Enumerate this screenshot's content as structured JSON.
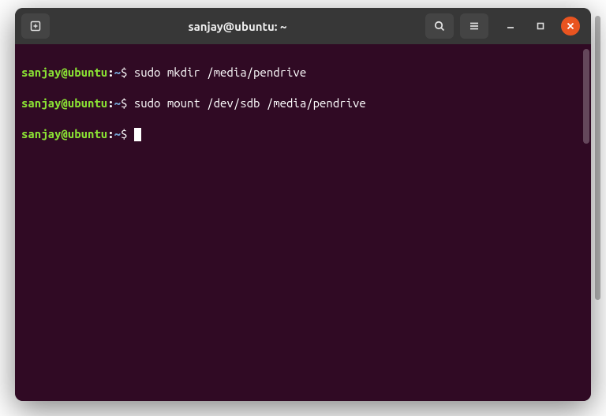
{
  "window": {
    "title": "sanjay@ubuntu: ~"
  },
  "terminal": {
    "lines": [
      {
        "user_host": "sanjay@ubuntu",
        "path": "~",
        "symbol": "$",
        "command": "sudo mkdir /media/pendrive"
      },
      {
        "user_host": "sanjay@ubuntu",
        "path": "~",
        "symbol": "$",
        "command": "sudo mount /dev/sdb /media/pendrive"
      },
      {
        "user_host": "sanjay@ubuntu",
        "path": "~",
        "symbol": "$",
        "command": ""
      }
    ]
  }
}
